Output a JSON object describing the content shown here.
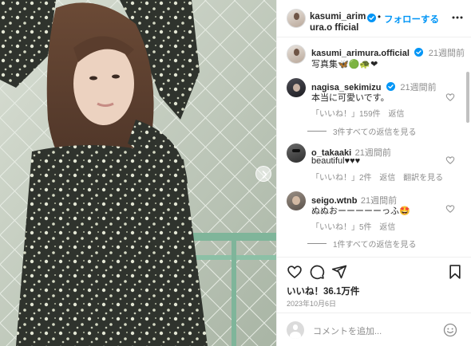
{
  "post": {
    "username": "kasumi_arimura.official",
    "username_wrapped": "kasumi_arimura.o fficial",
    "header_dot": "•",
    "follow_label": "フォローする"
  },
  "caption": {
    "username": "kasumi_arimura.official",
    "time": "21週間前",
    "text": "写真集🦋🟢🐢❤"
  },
  "comments": [
    {
      "username": "nagisa_sekimizu",
      "time": "21週間前",
      "text": "本当に可愛いです。",
      "likes": "「いいね！」159件",
      "reply": "返信",
      "translate": "",
      "view_replies": "3件すべての返信を見る"
    },
    {
      "username": "o_takaaki",
      "time": "21週間前",
      "text": "beautiful♥♥♥",
      "likes": "「いいね！」2件",
      "reply": "返信",
      "translate": "翻訳を見る",
      "view_replies": ""
    },
    {
      "username": "seigo.wtnb",
      "time": "21週間前",
      "text": "ぬぬおーーーーーっふ🤩",
      "likes": "「いいね！」5件",
      "reply": "返信",
      "translate": "",
      "view_replies": "1件すべての返信を見る"
    }
  ],
  "stats": {
    "likes": "いいね！36.1万件",
    "date": "2023年10月6日"
  },
  "comment_box": {
    "placeholder": "コメントを追加..."
  },
  "icons": {
    "verified": "verified-badge-icon",
    "more": "more-options-icon",
    "heart": "heart-icon",
    "comment": "comment-icon",
    "share": "share-icon",
    "save": "bookmark-icon",
    "emoji": "emoji-icon",
    "next": "chevron-right-icon"
  },
  "colors": {
    "accent": "#0095f6",
    "text": "#262626",
    "secondary": "#8e8e8e",
    "divider": "#efefef"
  }
}
